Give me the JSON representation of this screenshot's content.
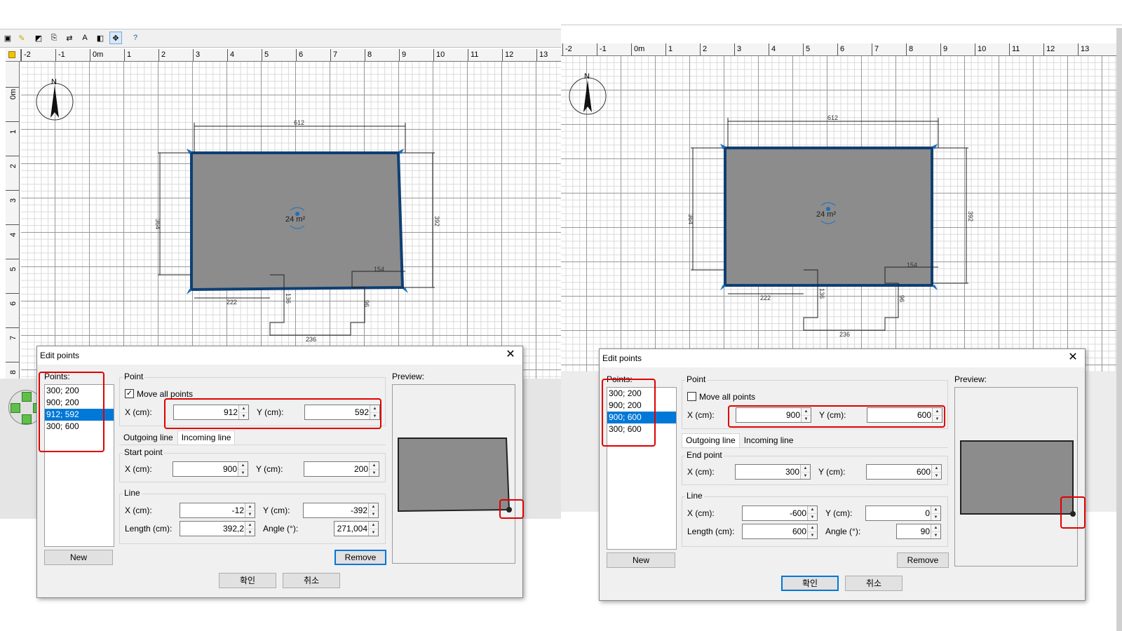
{
  "left": {
    "ruler_x": [
      "-2",
      "-1",
      "0m",
      "1",
      "2",
      "3",
      "4",
      "5",
      "6",
      "7",
      "8",
      "9",
      "10",
      "11",
      "12",
      "13"
    ],
    "ruler_y": [
      "0m",
      "1",
      "2",
      "3",
      "4",
      "5",
      "6",
      "7",
      "8"
    ],
    "plan": {
      "compass": "N",
      "area": "24 m²",
      "dims": {
        "top": "612",
        "left": "364",
        "right": "392",
        "bottom_left": "222",
        "notch_v": "136",
        "notch_w": "236",
        "notch_step": "96",
        "notch_top": "154"
      }
    },
    "dialog": {
      "title": "Edit points",
      "points_label": "Points:",
      "points": [
        "300; 200",
        "900; 200",
        "912; 592",
        "300; 600"
      ],
      "selected_index": 2,
      "point_group": "Point",
      "move_all_label": "Move all points",
      "move_all_checked": true,
      "x_label": "X (cm):",
      "y_label": "Y (cm):",
      "x_value": "912",
      "y_value": "592",
      "tabs": [
        "Outgoing line",
        "Incoming line"
      ],
      "active_tab": 1,
      "sub_group": "Start point",
      "sub_x": "900",
      "sub_y": "200",
      "line_group": "Line",
      "line_x": "-12",
      "line_y": "-392",
      "length_label": "Length (cm):",
      "length": "392,2",
      "angle_label": "Angle (°):",
      "angle": "271,004",
      "new_label": "New",
      "remove_label": "Remove",
      "ok_label": "확인",
      "cancel_label": "취소",
      "preview_label": "Preview:"
    }
  },
  "right": {
    "ruler_x": [
      "-2",
      "-1",
      "0m",
      "1",
      "2",
      "3",
      "4",
      "5",
      "6",
      "7",
      "8",
      "9",
      "10",
      "11",
      "12",
      "13"
    ],
    "plan": {
      "compass": "N",
      "area": "24 m²",
      "dims": {
        "top": "612",
        "left": "364",
        "right": "392",
        "bottom_left": "222",
        "notch_v": "136",
        "notch_w": "236",
        "notch_step": "96",
        "notch_top": "154"
      }
    },
    "dialog": {
      "title": "Edit points",
      "points_label": "Points:",
      "points": [
        "300; 200",
        "900; 200",
        "900; 600",
        "300; 600"
      ],
      "selected_index": 2,
      "point_group": "Point",
      "move_all_label": "Move all points",
      "move_all_checked": false,
      "x_label": "X (cm):",
      "y_label": "Y (cm):",
      "x_value": "900",
      "y_value": "600",
      "tabs": [
        "Outgoing line",
        "Incoming line"
      ],
      "active_tab": 0,
      "sub_group": "End point",
      "sub_x": "300",
      "sub_y": "600",
      "line_group": "Line",
      "line_x": "-600",
      "line_y": "0",
      "length_label": "Length (cm):",
      "length": "600",
      "angle_label": "Angle (°):",
      "angle": "90",
      "new_label": "New",
      "remove_label": "Remove",
      "ok_label": "확인",
      "cancel_label": "취소",
      "preview_label": "Preview:"
    }
  },
  "colors": {
    "highlight": "#e00000",
    "room_fill": "#8c8c8c",
    "wall": "#0f3f73",
    "selection": "#0078d7"
  }
}
